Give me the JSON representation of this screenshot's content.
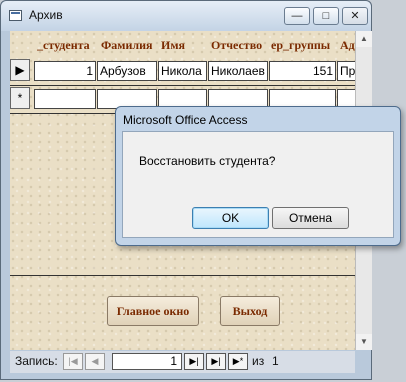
{
  "window": {
    "title": "Архив",
    "minimize_icon": "minimize-icon",
    "maximize_icon": "maximize-icon",
    "close_icon": "close-icon"
  },
  "columns": [
    "_студента",
    "Фамилия",
    "Имя",
    "Отчество",
    "ер_группы",
    "Ад"
  ],
  "rows": [
    {
      "selector": "▶",
      "cells": [
        "1",
        "Арбузов",
        "Никола",
        "Николаев",
        "151",
        "Пр"
      ]
    },
    {
      "selector": "*",
      "cells": [
        "",
        "",
        "",
        "",
        "",
        ""
      ]
    }
  ],
  "buttons": {
    "main_window": "Главное окно",
    "exit": "Выход"
  },
  "navigation": {
    "label": "Запись:",
    "first": "|◀",
    "prev": "◀",
    "current": "1",
    "next": "▶|",
    "last": "▶|",
    "new": "▶*",
    "of": "из",
    "total": "1"
  },
  "dialog": {
    "title": "Microsoft Office Access",
    "message": "Восстановить студента?",
    "ok": "OK",
    "cancel": "Отмена"
  },
  "colors": {
    "header_text": "#7a2a00",
    "dialog_frame": "#c2d4e8"
  }
}
